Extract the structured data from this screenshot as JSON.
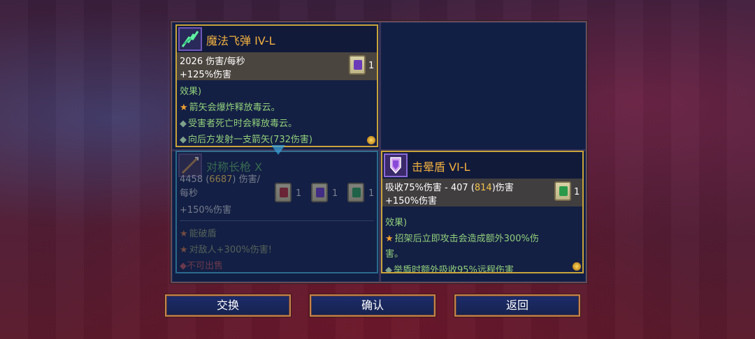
{
  "colors": {
    "gold_border": "#c9a43a",
    "cyan_border": "#3ea6c8",
    "title_orange": "#f0b040",
    "effect_green": "#90d07a",
    "highlight_yellow": "#f0c24a",
    "button_border": "#c8834a"
  },
  "cards": {
    "magic_missile": {
      "icon": "magic-missile-icon",
      "title": "魔法飞弹 IV-L",
      "stat1": "2026 伤害/每秒",
      "stat2": "+125%伤害",
      "scroll_count": "1",
      "effects_header": "效果)",
      "effect1": "箭矢会爆炸释放毒云。",
      "effect2": "受害者死亡时会释放毒云。",
      "effect3": "向后方发射一支箭矢(732伤害)"
    },
    "spear": {
      "icon": "spear-icon",
      "title": "对称长枪 X",
      "stat1_a": "4458 (",
      "stat1_hl": "6687",
      "stat1_b": ") 伤害/",
      "stat2": "每秒",
      "stat3": "+150%伤害",
      "scroll_counts": [
        "1",
        "1",
        "1"
      ],
      "effect1": "能破盾",
      "effect2": "对敌人+300%伤害!",
      "effect3": "不可出售"
    },
    "stun_shield": {
      "icon": "stun-shield-icon",
      "title": "击晕盾 VI-L",
      "stat1_a": "吸收75%伤害 - 407 (",
      "stat1_hl": "814",
      "stat1_b": ")伤害",
      "stat2": "+150%伤害",
      "scroll_count": "1",
      "effects_header": "效果)",
      "effect1": "招架后立即攻击会造成额外300%伤",
      "effect1b": "害。",
      "effect2": "举盾时额外吸收95%远程伤害"
    }
  },
  "buttons": {
    "swap": "交换",
    "confirm": "确认",
    "back": "返回"
  }
}
